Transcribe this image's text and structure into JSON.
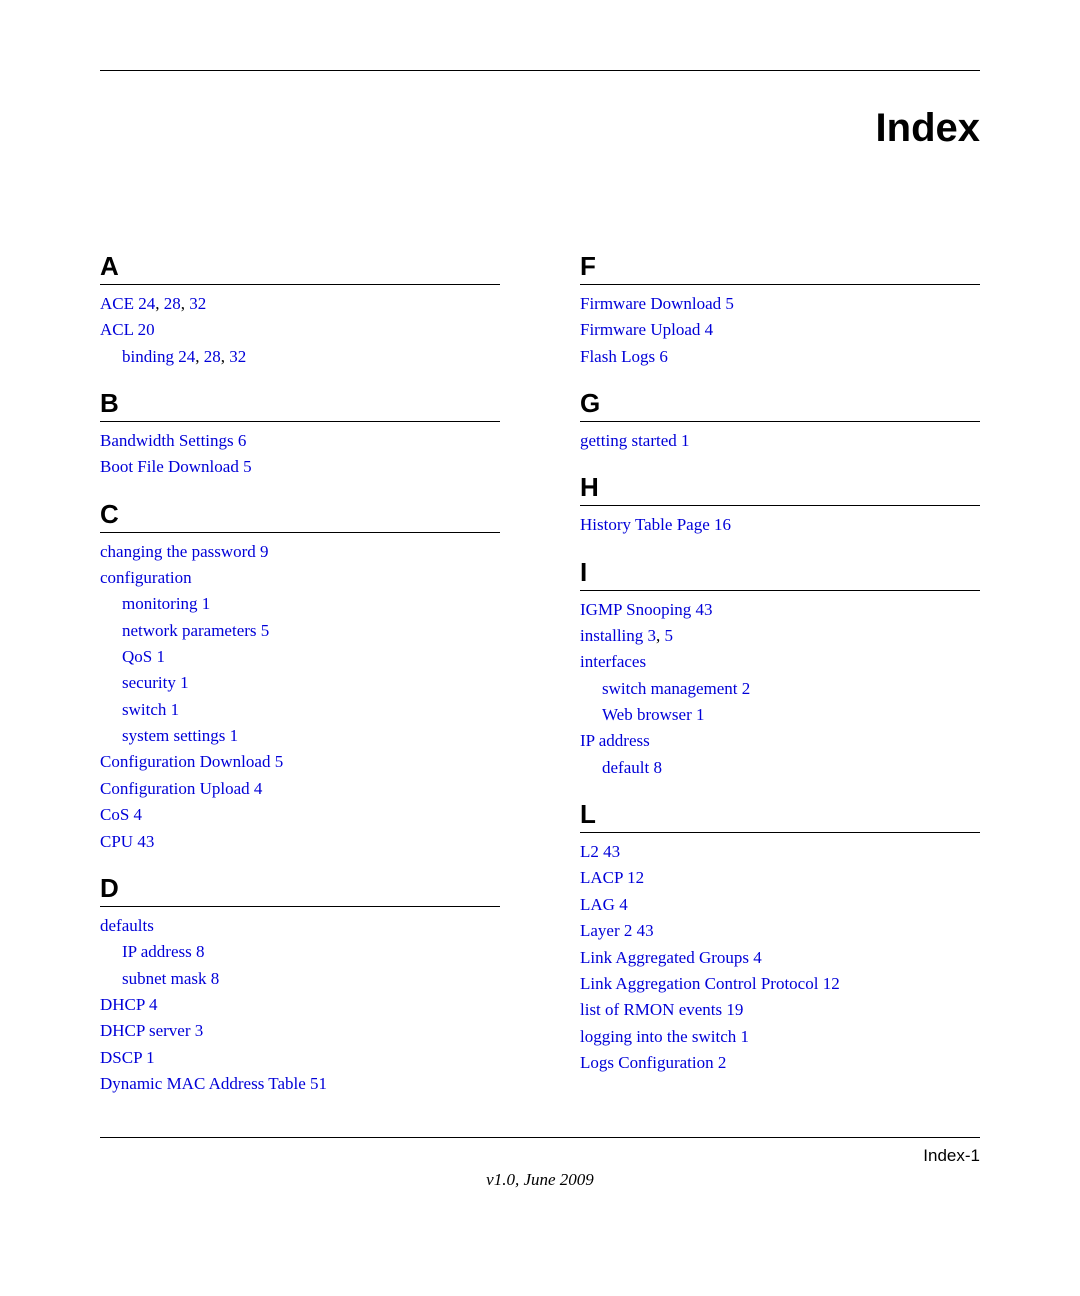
{
  "title": "Index",
  "footer_page": "Index-1",
  "footer_version": "v1.0, June 2009",
  "left": {
    "A": {
      "letter": "A",
      "ace": "ACE 24",
      "ace_p2": "28",
      "ace_p3": "32",
      "acl": "ACL 20",
      "binding": "binding 24",
      "binding_p2": "28",
      "binding_p3": "32"
    },
    "B": {
      "letter": "B",
      "bandwidth": "Bandwidth Settings 6",
      "bootfile": "Boot File Download 5"
    },
    "C": {
      "letter": "C",
      "changepw": "changing the password 9",
      "config": "configuration",
      "monitoring": "monitoring 1",
      "netparams": "network parameters 5",
      "qos": "QoS 1",
      "security": "security 1",
      "switch": "switch 1",
      "syssettings": "system settings 1",
      "confdl": "Configuration Download 5",
      "conful": "Configuration Upload 4",
      "cos": "CoS 4",
      "cpu": "CPU 43"
    },
    "D": {
      "letter": "D",
      "defaults": "defaults",
      "ipaddr": "IP address 8",
      "subnet": "subnet mask 8",
      "dhcp": "DHCP 4",
      "dhcpserver": "DHCP server 3",
      "dscp": "DSCP 1",
      "dynmac": "Dynamic MAC Address Table 51"
    }
  },
  "right": {
    "F": {
      "letter": "F",
      "fwdl": "Firmware Download 5",
      "fwul": "Firmware Upload 4",
      "flash": "Flash Logs 6"
    },
    "G": {
      "letter": "G",
      "getstart": "getting started 1"
    },
    "H": {
      "letter": "H",
      "hist": "History Table Page 16"
    },
    "I": {
      "letter": "I",
      "igmp": "IGMP Snooping 43",
      "install": "installing 3",
      "install_p2": "5",
      "interfaces": "interfaces",
      "swmgmt": "switch management 2",
      "webbrowser": "Web browser 1",
      "ipaddr": "IP address",
      "default": "default 8"
    },
    "L": {
      "letter": "L",
      "l2": "L2 43",
      "lacp": "LACP 12",
      "lag": "LAG 4",
      "layer2": "Layer 2 43",
      "lagroups": "Link Aggregated Groups 4",
      "lacproto": "Link Aggregation Control Protocol 12",
      "rmon": "list of RMON events 19",
      "login": "logging into the switch 1",
      "logsconf": "Logs Configuration 2"
    }
  }
}
